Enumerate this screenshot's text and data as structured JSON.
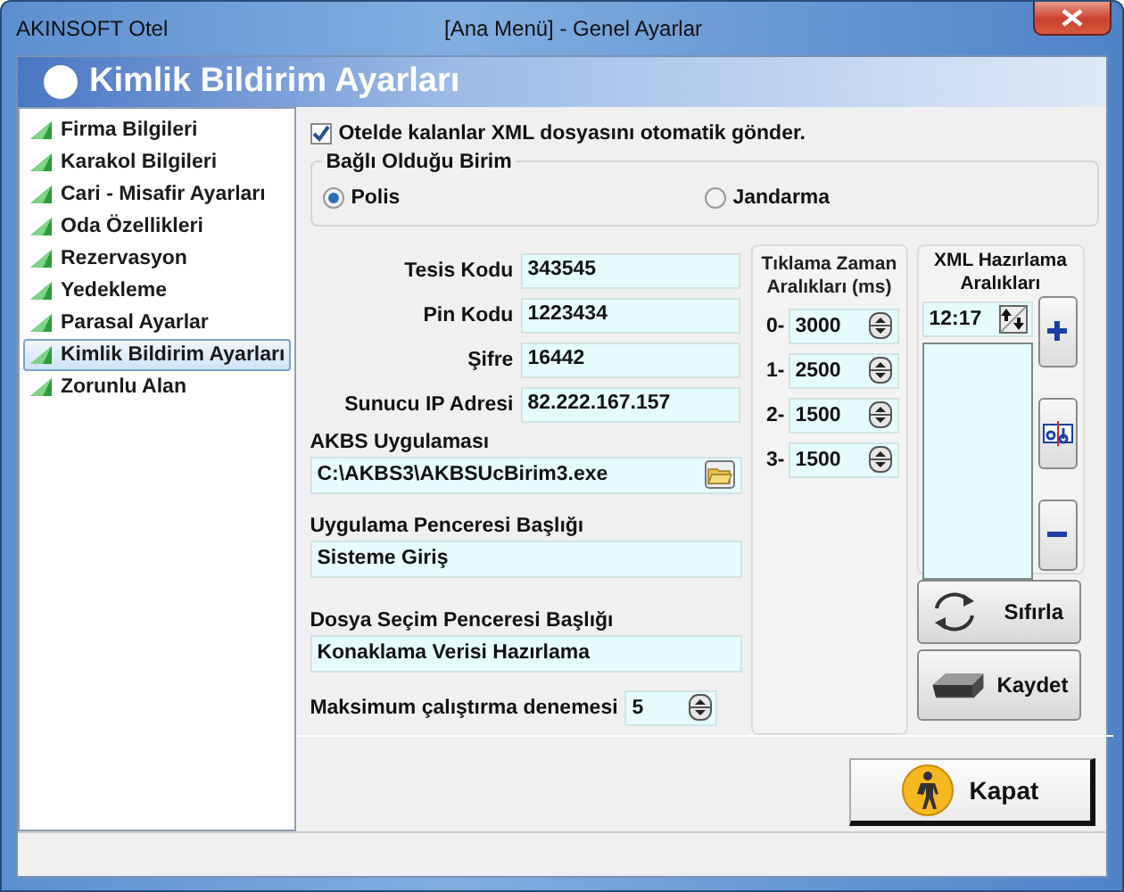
{
  "window": {
    "title": "AKINSOFT Otel",
    "subtitle": "[Ana Menü] - Genel Ayarlar"
  },
  "header": {
    "title": "Kimlik Bildirim Ayarları"
  },
  "sidebar": {
    "items": [
      {
        "label": "Firma Bilgileri",
        "selected": false
      },
      {
        "label": "Karakol Bilgileri",
        "selected": false
      },
      {
        "label": "Cari - Misafir Ayarları",
        "selected": false
      },
      {
        "label": "Oda Özellikleri",
        "selected": false
      },
      {
        "label": "Rezervasyon",
        "selected": false
      },
      {
        "label": "Yedekleme",
        "selected": false
      },
      {
        "label": "Parasal Ayarlar",
        "selected": false
      },
      {
        "label": "Kimlik Bildirim Ayarları",
        "selected": true
      },
      {
        "label": "Zorunlu Alan",
        "selected": false
      }
    ]
  },
  "auto_send": {
    "label": "Otelde kalanlar XML dosyasını otomatik gönder.",
    "checked": true
  },
  "unit_group": {
    "title": "Bağlı Olduğu Birim",
    "options": [
      {
        "label": "Polis",
        "selected": true
      },
      {
        "label": "Jandarma",
        "selected": false
      }
    ]
  },
  "fields": [
    {
      "label": "Tesis Kodu",
      "value": "343545"
    },
    {
      "label": "Pin Kodu",
      "value": "1223434"
    },
    {
      "label": "Şifre",
      "value": "16442"
    },
    {
      "label": "Sunucu IP Adresi",
      "value": "82.222.167.157"
    }
  ],
  "akbs_app": {
    "label": "AKBS Uygulaması",
    "value": "C:\\AKBS3\\AKBSUcBirim3.exe"
  },
  "app_window_title": {
    "label": "Uygulama Penceresi Başlığı",
    "value": "Sisteme Giriş"
  },
  "file_dialog_title": {
    "label": "Dosya Seçim Penceresi Başlığı",
    "value": "Konaklama Verisi Hazırlama"
  },
  "max_attempts": {
    "label": "Maksimum çalıştırma denemesi",
    "value": "5"
  },
  "click_intervals": {
    "title": "Tıklama Zaman Aralıkları (ms)",
    "rows": [
      {
        "index": "0-",
        "value": "3000"
      },
      {
        "index": "1-",
        "value": "2500"
      },
      {
        "index": "2-",
        "value": "1500"
      },
      {
        "index": "3-",
        "value": "1500"
      }
    ]
  },
  "xml_intervals": {
    "title": "XML Hazırlama Aralıkları",
    "time": "12:17"
  },
  "buttons": {
    "reset": "Sıfırla",
    "save": "Kaydet",
    "close": "Kapat"
  }
}
